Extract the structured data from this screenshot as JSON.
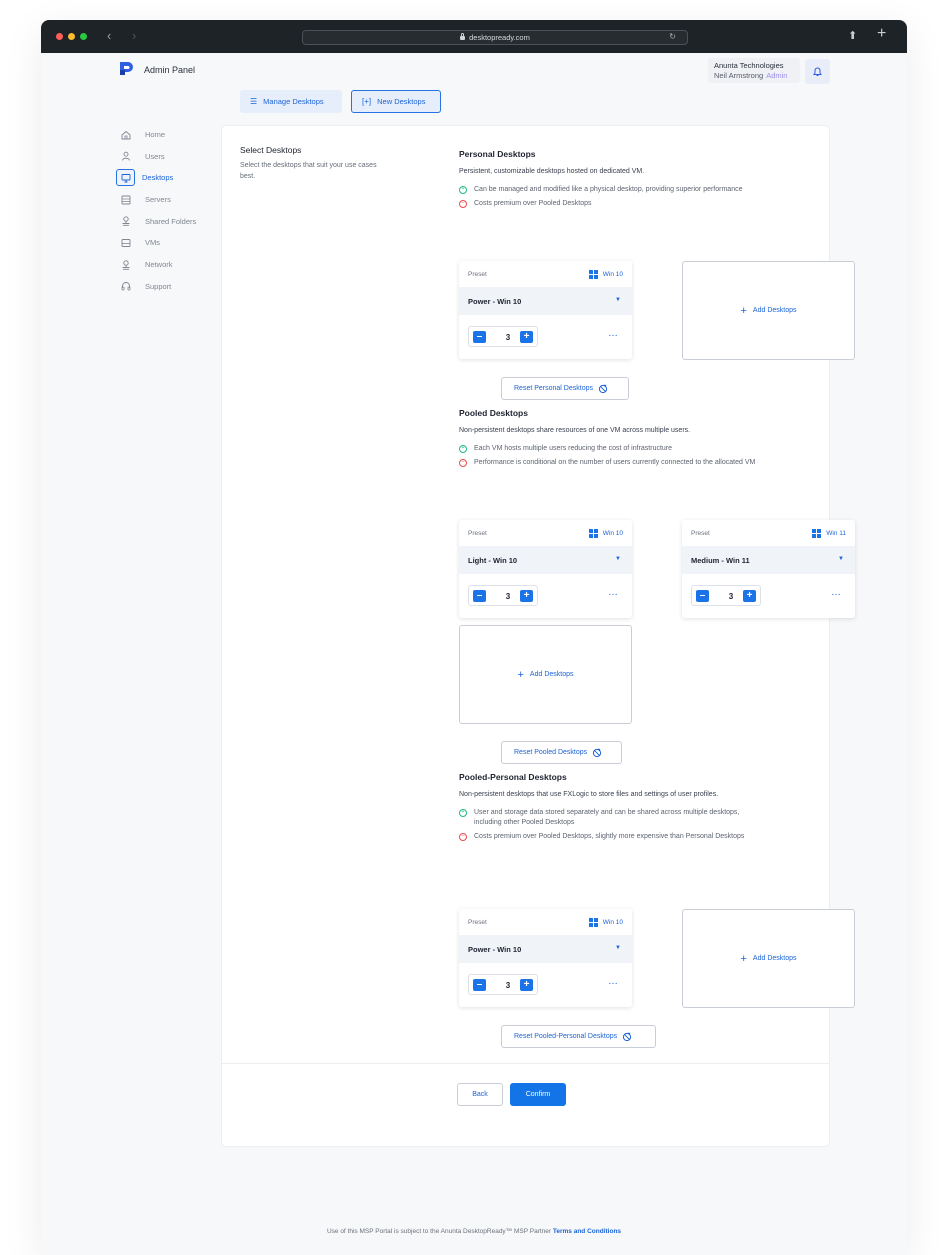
{
  "browser": {
    "url": "desktopready.com"
  },
  "header": {
    "app_title": "Admin Panel",
    "org_name": "Anunta Technologies",
    "user_name": "Neil Armstrong",
    "user_role": "Admin"
  },
  "tabs": {
    "manage": "Manage Desktops",
    "new": "New Desktops"
  },
  "sidebar": {
    "items": [
      {
        "label": "Home",
        "icon": "home-icon"
      },
      {
        "label": "Users",
        "icon": "user-icon"
      },
      {
        "label": "Desktops",
        "icon": "monitor-icon",
        "active": true
      },
      {
        "label": "Servers",
        "icon": "server-icon"
      },
      {
        "label": "Shared Folders",
        "icon": "shared-folder-icon"
      },
      {
        "label": "VMs",
        "icon": "vm-icon"
      },
      {
        "label": "Network",
        "icon": "network-icon"
      },
      {
        "label": "Support",
        "icon": "headset-icon"
      }
    ]
  },
  "main": {
    "section_title": "Select Desktops",
    "section_desc": "Select the desktops that suit your use cases best.",
    "personal": {
      "title": "Personal Desktops",
      "desc": "Persistent, customizable desktops hosted on dedicated VM.",
      "pro": "Can be managed and modified like a physical desktop, providing superior performance",
      "con": "Costs premium over Pooled Desktops",
      "card1": {
        "preset_label": "Preset",
        "os": "Win 10",
        "preset": "Power - Win 10",
        "qty": "3"
      },
      "add_label": "Add Desktops",
      "reset_label": "Reset Personal Desktops"
    },
    "pooled": {
      "title": "Pooled Desktops",
      "desc": "Non-persistent desktops share resources of one VM across multiple users.",
      "pro": "Each VM hosts multiple users reducing the cost of infrastructure",
      "con": "Performance is conditional on the number of users currently connected to the allocated VM",
      "card1": {
        "preset_label": "Preset",
        "os": "Win 10",
        "preset": "Light - Win 10",
        "qty": "3"
      },
      "card2": {
        "preset_label": "Preset",
        "os": "Win 11",
        "preset": "Medium - Win 11",
        "qty": "3"
      },
      "add_label": "Add Desktops",
      "reset_label": "Reset Pooled Desktops"
    },
    "pooled_personal": {
      "title": "Pooled-Personal Desktops",
      "desc": "Non-persistent desktops that use FXLogic to store files and settings of user profiles.",
      "pro": "User and storage data stored separately and can be shared across multiple desktops, including other Pooled Desktops",
      "con": "Costs premium over Pooled Desktops, slightly more expensive than Personal Desktops",
      "card1": {
        "preset_label": "Preset",
        "os": "Win 10",
        "preset": "Power - Win 10",
        "qty": "3"
      },
      "add_label": "Add Desktops",
      "reset_label": "Reset Pooled-Personal Desktops"
    },
    "back_label": "Back",
    "confirm_label": "Confirm"
  },
  "footer": {
    "text": "Use of this MSP Portal is subject to the Anunta DesktopReady™ MSP Partner",
    "link": "Terms and Conditions"
  },
  "colors": {
    "accent": "#1274e6",
    "pro": "#23b883",
    "con": "#ea4b4b"
  }
}
